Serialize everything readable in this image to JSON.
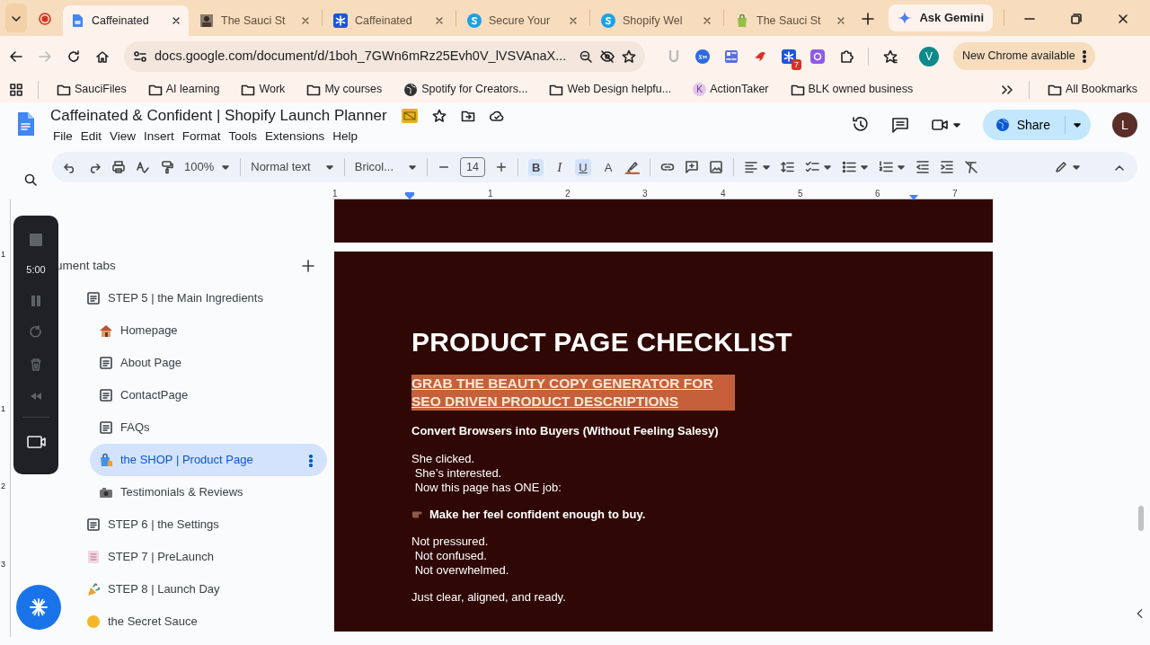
{
  "browser_tabs": [
    {
      "title": "Caffeinated",
      "kind": "docs",
      "selected": true
    },
    {
      "title": "The Sauci St",
      "kind": "photo",
      "selected": false
    },
    {
      "title": "Caffeinated",
      "kind": "snowflake",
      "selected": false
    },
    {
      "title": "Secure Your",
      "kind": "circle-s",
      "selected": false
    },
    {
      "title": "Shopify Wel",
      "kind": "circle-s",
      "selected": false
    },
    {
      "title": "The Sauci St",
      "kind": "bag",
      "selected": false
    }
  ],
  "gemini": {
    "label": "Ask Gemini"
  },
  "address_bar": {
    "url": "docs.google.com/document/d/1boh_7GWn6mRz25Evh0V_lVSVAnaX..."
  },
  "extensions": {
    "badge": "7"
  },
  "profile": {
    "initial": "V"
  },
  "update": {
    "label": "New Chrome available"
  },
  "bookmarks": [
    {
      "label": "SauciFiles",
      "kind": "folder"
    },
    {
      "label": "AI learning",
      "kind": "folder"
    },
    {
      "label": "Work",
      "kind": "folder"
    },
    {
      "label": "My courses",
      "kind": "folder"
    },
    {
      "label": "Spotify for Creators...",
      "kind": "globe"
    },
    {
      "label": "Web Design helpfu...",
      "kind": "folder"
    },
    {
      "label": "ActionTaker",
      "kind": "letter",
      "letter": "K"
    },
    {
      "label": "BLK owned business",
      "kind": "folder"
    }
  ],
  "all_bookmarks": {
    "label": "All Bookmarks"
  },
  "doc": {
    "title": "Caffeinated & Confident | Shopify Launch Planner",
    "menu": [
      "File",
      "Edit",
      "View",
      "Insert",
      "Format",
      "Tools",
      "Extensions",
      "Help"
    ],
    "share": "Share",
    "user_initial": "L"
  },
  "toolbar": {
    "zoom": "100%",
    "style": "Normal text",
    "font": "Bricol...",
    "size": "14",
    "toggles": [
      {
        "label": "B",
        "kind": "bold",
        "selected": true
      },
      {
        "label": "I",
        "kind": "italic",
        "selected": false
      },
      {
        "label": "U",
        "kind": "underline",
        "selected": true
      }
    ],
    "text_color": "A"
  },
  "ruler": [
    "1",
    "1",
    "2",
    "3",
    "4",
    "5",
    "6",
    "7"
  ],
  "vertical_ruler": [
    "1",
    "1",
    "2",
    "3"
  ],
  "sidebar": {
    "heading": "ument tabs",
    "tabs": [
      {
        "label": "STEP 5 | the Main Ingredients",
        "kind": "doc",
        "selected": false,
        "children": [
          {
            "label": "Homepage",
            "kind": "house",
            "selected": false
          },
          {
            "label": "About Page",
            "kind": "doc",
            "selected": false
          },
          {
            "label": "ContactPage",
            "kind": "doc",
            "selected": false
          },
          {
            "label": "FAQs",
            "kind": "doc",
            "selected": false
          },
          {
            "label": "the SHOP | Product Page",
            "kind": "bag",
            "selected": true
          },
          {
            "label": "Testimonials & Reviews",
            "kind": "camera",
            "selected": false
          }
        ]
      },
      {
        "label": "STEP 6 | the Settings",
        "kind": "doc",
        "selected": false
      },
      {
        "label": "STEP 7 | PreLaunch",
        "kind": "notepad",
        "selected": false
      },
      {
        "label": "STEP 8 | Launch Day",
        "kind": "party",
        "selected": false
      },
      {
        "label": "the Secret Sauce",
        "kind": "smile",
        "selected": false
      }
    ]
  },
  "recorder": {
    "timer": "5:00"
  },
  "document": {
    "title": "PRODUCT PAGE CHECKLIST",
    "link": "GRAB THE BEAUTY COPY GENERATOR FOR SEO DRIVEN PRODUCT DESCRIPTIONS",
    "subtitle": "Convert Browsers into Buyers (Without Feeling Salesy)",
    "blocks": [
      {
        "kind": "text",
        "text": "She clicked.\n She’s interested.\n Now this page has ONE job:"
      },
      {
        "kind": "pointer",
        "text": "Make her feel confident enough to buy."
      },
      {
        "kind": "text",
        "text": "Not pressured.\n Not confused.\n Not overwhelmed."
      },
      {
        "kind": "text",
        "text": "Just clear, aligned, and ready."
      }
    ]
  }
}
